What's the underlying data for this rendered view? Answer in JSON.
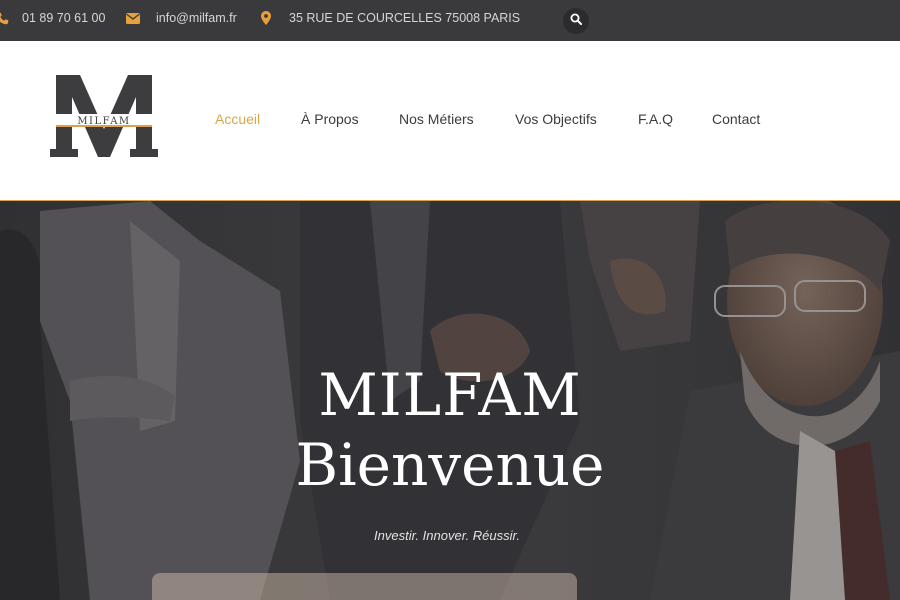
{
  "topbar": {
    "phone": {
      "icon": "phone-icon",
      "text": "01 89 70 61 00"
    },
    "email": {
      "icon": "envelope-icon",
      "text": "info@milfam.fr"
    },
    "address": {
      "icon": "map-marker-icon",
      "text": "35 RUE DE COURCELLES 75008 PARIS"
    },
    "search_icon": "search-icon"
  },
  "logo": {
    "letter": "M",
    "wordmark": "MILFAM"
  },
  "nav": {
    "items": [
      {
        "label": "Accueil",
        "active": true
      },
      {
        "label": "À Propos",
        "active": false
      },
      {
        "label": "Nos Métiers",
        "active": false
      },
      {
        "label": "Vos Objectifs",
        "active": false
      },
      {
        "label": "F.A.Q",
        "active": false
      },
      {
        "label": "Contact",
        "active": false
      }
    ]
  },
  "hero": {
    "title_line1": "MILFAM",
    "title_line2": "Bienvenue",
    "tagline": "Investir. Innover. Réussir."
  },
  "colors": {
    "accent": "#e8a03a",
    "active_nav": "#d9a64a",
    "topbar_bg": "#3a3a3c",
    "logo_dark": "#3d3d3f"
  }
}
